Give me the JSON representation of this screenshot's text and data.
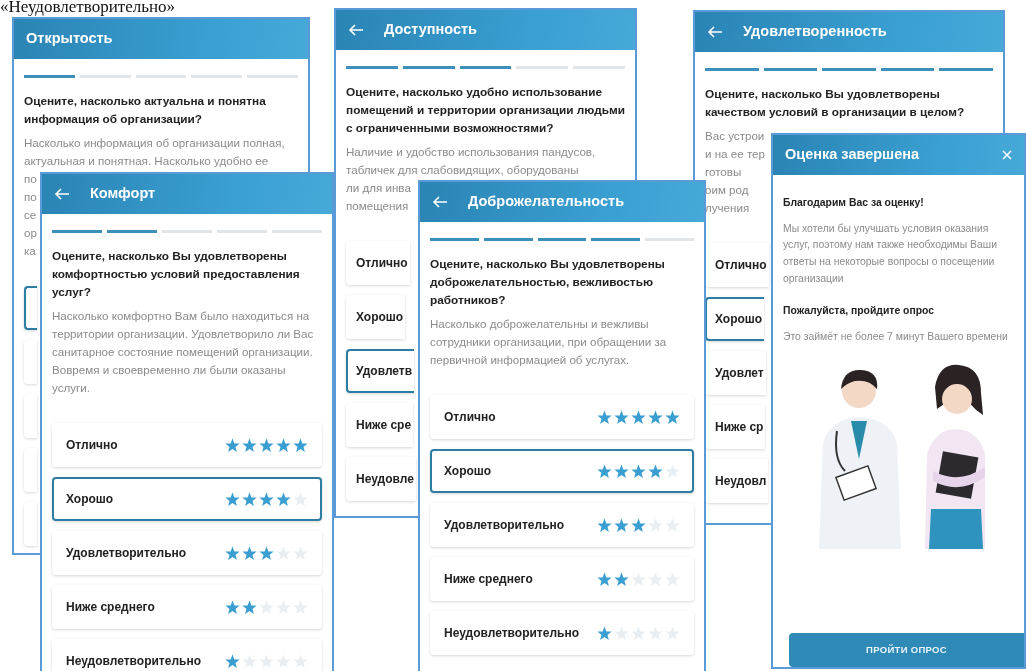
{
  "caption": "«Неудовлетворительно»",
  "screens": [
    {
      "kind": "rating",
      "title": "Открытость",
      "back_arrow": false,
      "steps": [
        true,
        false,
        false,
        false,
        false
      ],
      "question": "Оцените, насколько актуальна и понятна информация об организации?",
      "description_lines": [
        "Насколько информация об организации полная,",
        "актуальная и понятная. Насколько удобно ее",
        "по",
        "по",
        "се",
        "ор",
        "ка"
      ],
      "options": [
        {
          "selected": true
        },
        {
          "selected": false
        },
        {
          "selected": false
        },
        {
          "selected": false
        },
        {
          "selected": false
        }
      ]
    },
    {
      "kind": "rating",
      "title": "Доступность",
      "back_arrow": true,
      "steps": [
        true,
        true,
        true,
        false,
        false
      ],
      "question": "Оцените, насколько удобно использование помещений и территории организации людьми с ограниченными возможностями?",
      "description_lines": [
        "Наличие и удобство использования пандусов,",
        "табличек для слабовидящих, оборудованы",
        "ли для инва",
        "помещения"
      ],
      "options": [
        {
          "label": "Отлично",
          "selected": false
        },
        {
          "label": "Хорошо",
          "selected": false
        },
        {
          "label": "Удовлетв",
          "selected": true
        },
        {
          "label": "Ниже сре",
          "selected": false
        },
        {
          "label": "Неудовле",
          "selected": false
        }
      ]
    },
    {
      "kind": "rating",
      "title": "Удовлетворенность",
      "back_arrow": true,
      "steps": [
        true,
        true,
        true,
        true,
        true
      ],
      "question": "Оцените, насколько Вы удовлетворены качеством условий в организации в целом?",
      "description_lines": [
        "Вас устрои",
        "и на ее тер",
        "готовы",
        "оим род",
        "лучения"
      ],
      "options": [
        {
          "label": "Отлично",
          "selected": false
        },
        {
          "label": "Хорошо",
          "selected": true
        },
        {
          "label": "Удовлет",
          "selected": false
        },
        {
          "label": "Ниже ср",
          "selected": false
        },
        {
          "label": "Неудовл",
          "selected": false
        }
      ]
    },
    {
      "kind": "rating",
      "title": "Комфорт",
      "back_arrow": true,
      "steps": [
        true,
        true,
        false,
        false,
        false
      ],
      "question": "Оцените, насколько Вы удовлетворены комфортностью условий предоставления услуг?",
      "description": "Насколько комфортно Вам было находиться на территории организации. Удовлетворило ли Вас санитарное состояние помещений организации. Вовремя и своевременно ли были оказаны услуги.",
      "options": [
        {
          "label": "Отлично",
          "stars": 5,
          "selected": false
        },
        {
          "label": "Хорошо",
          "stars": 4,
          "selected": true
        },
        {
          "label": "Удовлетворительно",
          "stars": 3,
          "selected": false
        },
        {
          "label": "Ниже среднего",
          "stars": 2,
          "selected": false
        },
        {
          "label": "Неудовлетворительно",
          "stars": 1,
          "selected": false
        }
      ]
    },
    {
      "kind": "rating",
      "title": "Доброжелательность",
      "back_arrow": true,
      "steps": [
        true,
        true,
        true,
        true,
        false
      ],
      "question": "Оцените, насколько Вы удовлетворены доброжелательностью, вежливостью работников?",
      "description": "Насколько доброжелательны и вежливы сотрудники организации, при обращении за первичной информацией об услугах.",
      "options": [
        {
          "label": "Отлично",
          "stars": 5,
          "selected": false
        },
        {
          "label": "Хорошо",
          "stars": 4,
          "selected": true
        },
        {
          "label": "Удовлетворительно",
          "stars": 3,
          "selected": false
        },
        {
          "label": "Ниже среднего",
          "stars": 2,
          "selected": false
        },
        {
          "label": "Неудовлетворительно",
          "stars": 1,
          "selected": false
        }
      ]
    },
    {
      "kind": "completion",
      "title": "Оценка завершена",
      "close": true,
      "thanks": "Благодарим Вас за оценку!",
      "message": "Мы хотели бы улучшать условия оказания услуг, поэтому нам также необходимы Ваши ответы на некоторые вопросы о посещении организации",
      "prompt": "Пожалуйста, пройдите опрос",
      "note": "Это займёт не более 7 минут Вашего времени",
      "button": "ПРОЙТИ ОПРОС"
    }
  ]
}
